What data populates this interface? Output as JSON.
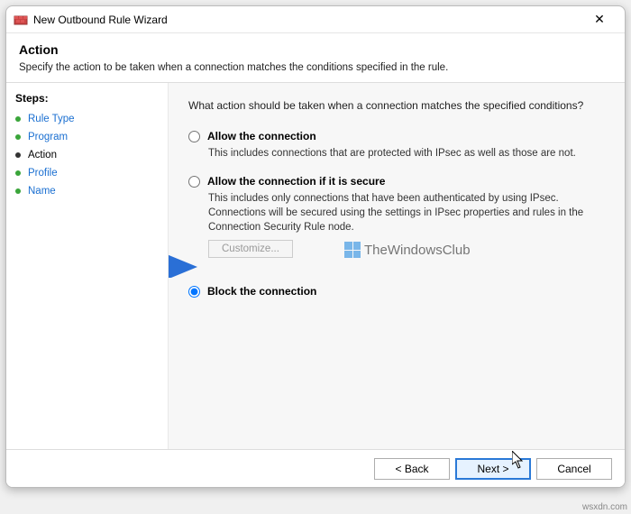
{
  "window": {
    "title": "New Outbound Rule Wizard"
  },
  "header": {
    "title": "Action",
    "subtitle": "Specify the action to be taken when a connection matches the conditions specified in the rule."
  },
  "steps": {
    "title": "Steps:",
    "items": [
      {
        "label": "Rule Type",
        "current": false
      },
      {
        "label": "Program",
        "current": false
      },
      {
        "label": "Action",
        "current": true
      },
      {
        "label": "Profile",
        "current": false
      },
      {
        "label": "Name",
        "current": false
      }
    ]
  },
  "content": {
    "question": "What action should be taken when a connection matches the specified conditions?",
    "options": [
      {
        "id": "allow",
        "label": "Allow the connection",
        "desc": "This includes connections that are protected with IPsec as well as those are not.",
        "selected": false
      },
      {
        "id": "allow-secure",
        "label": "Allow the connection if it is secure",
        "desc": "This includes only connections that have been authenticated by using IPsec. Connections will be secured using the settings in IPsec properties and rules in the Connection Security Rule node.",
        "selected": false,
        "customize": "Customize..."
      },
      {
        "id": "block",
        "label": "Block the connection",
        "desc": "",
        "selected": true
      }
    ]
  },
  "watermark": {
    "text": "TheWindowsClub"
  },
  "footer": {
    "back": "< Back",
    "next": "Next >",
    "cancel": "Cancel"
  },
  "domain_label": "wsxdn.com"
}
